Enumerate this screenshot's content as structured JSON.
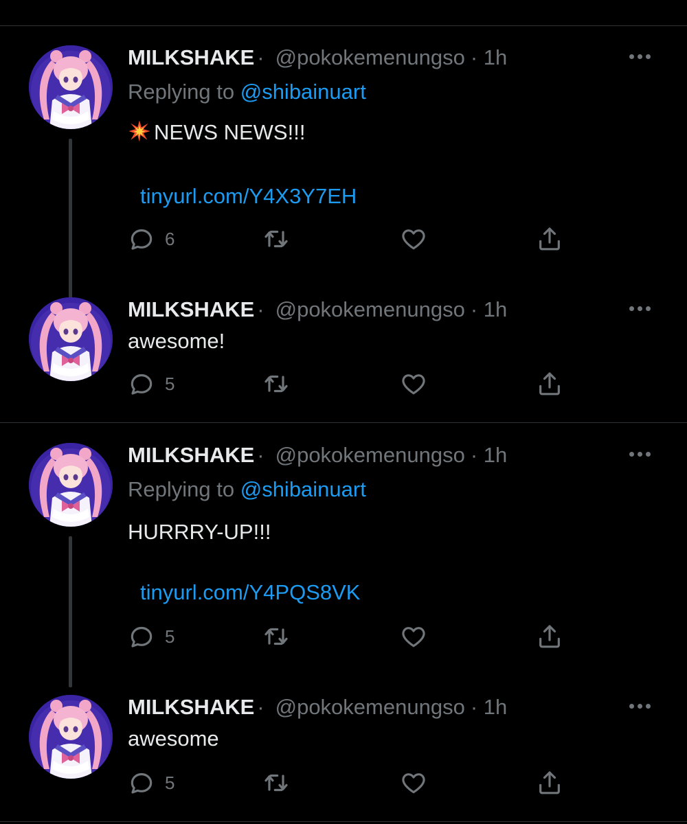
{
  "tweets": [
    {
      "name": "MILKSHAKE",
      "name_sep": "·",
      "handle": "@pokokemenungso",
      "time": "· 1h",
      "replying_label": "Replying to",
      "replying_handle": "@shibainuart",
      "text_icon": "collision-emoji-icon",
      "text": "NEWS NEWS!!!",
      "link": "tinyurl.com/Y4X3Y7EH",
      "replies": "6"
    },
    {
      "name": "MILKSHAKE",
      "name_sep": "·",
      "handle": "@pokokemenungso",
      "time": "· 1h",
      "text": "awesome!",
      "replies": "5"
    },
    {
      "name": "MILKSHAKE",
      "name_sep": "·",
      "handle": "@pokokemenungso",
      "time": "· 1h",
      "replying_label": "Replying to",
      "replying_handle": "@shibainuart",
      "text": "HURRRY-UP!!!",
      "link": "tinyurl.com/Y4PQS8VK",
      "replies": "5"
    },
    {
      "name": "MILKSHAKE",
      "name_sep": "·",
      "handle": "@pokokemenungso",
      "time": "· 1h",
      "text": "awesome",
      "replies": "5"
    }
  ],
  "icons": {
    "reply": "reply-icon",
    "retweet": "retweet-icon",
    "like": "heart-icon",
    "share": "share-icon",
    "more": "more-icon"
  },
  "colors": {
    "background": "#000000",
    "text": "#e7e9ea",
    "muted": "#71767b",
    "accent": "#1d9bf0",
    "divider": "#2f3336"
  }
}
